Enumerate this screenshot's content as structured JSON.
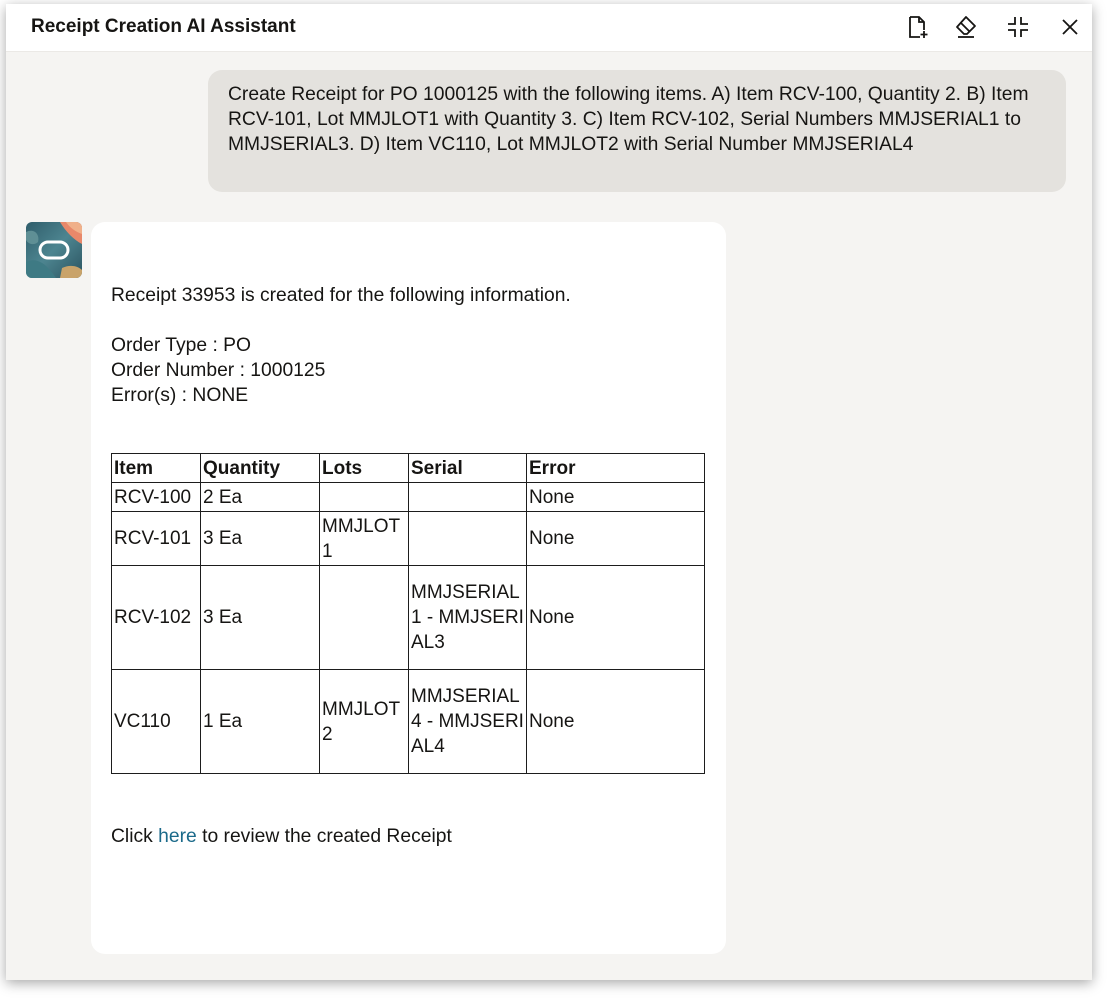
{
  "header": {
    "title": "Receipt Creation AI Assistant",
    "icons": [
      "new-document-icon",
      "eraser-icon",
      "collapse-icon",
      "close-icon"
    ]
  },
  "user_message": {
    "text": "Create Receipt for PO 1000125 with the following items. A) Item RCV-100, Quantity 2. B) Item RCV-101, Lot MMJLOT1 with Quantity 3. C) Item RCV-102, Serial Numbers MMJSERIAL1 to MMJSERIAL3. D) Item VC110, Lot MMJLOT2 with Serial Number MMJSERIAL4"
  },
  "bot_message": {
    "intro": "Receipt 33953 is created for the following information.",
    "order_type": "Order Type : PO",
    "order_number": "Order Number : 1000125",
    "errors": "Error(s) : NONE",
    "table": {
      "headers": [
        "Item",
        "Quantity",
        "Lots",
        "Serial",
        "Error"
      ],
      "rows": [
        [
          "RCV-100",
          "2 Ea",
          "",
          "",
          "None"
        ],
        [
          "RCV-101",
          "3 Ea",
          "MMJLOT1",
          "",
          "None"
        ],
        [
          "RCV-102",
          "3 Ea",
          "",
          "MMJSERIAL1 - MMJSERIAL3",
          "None"
        ],
        [
          "VC110",
          "1 Ea",
          "MMJLOT2",
          "MMJSERIAL4 - MMJSERIAL4",
          "None"
        ]
      ]
    },
    "footer_prefix": "Click",
    "footer_link": "here",
    "footer_suffix": "to review the created Receipt"
  },
  "colors": {
    "window_bg": "#f5f4f2",
    "user_bubble": "#e4e2de",
    "link": "#1b6a8a"
  }
}
